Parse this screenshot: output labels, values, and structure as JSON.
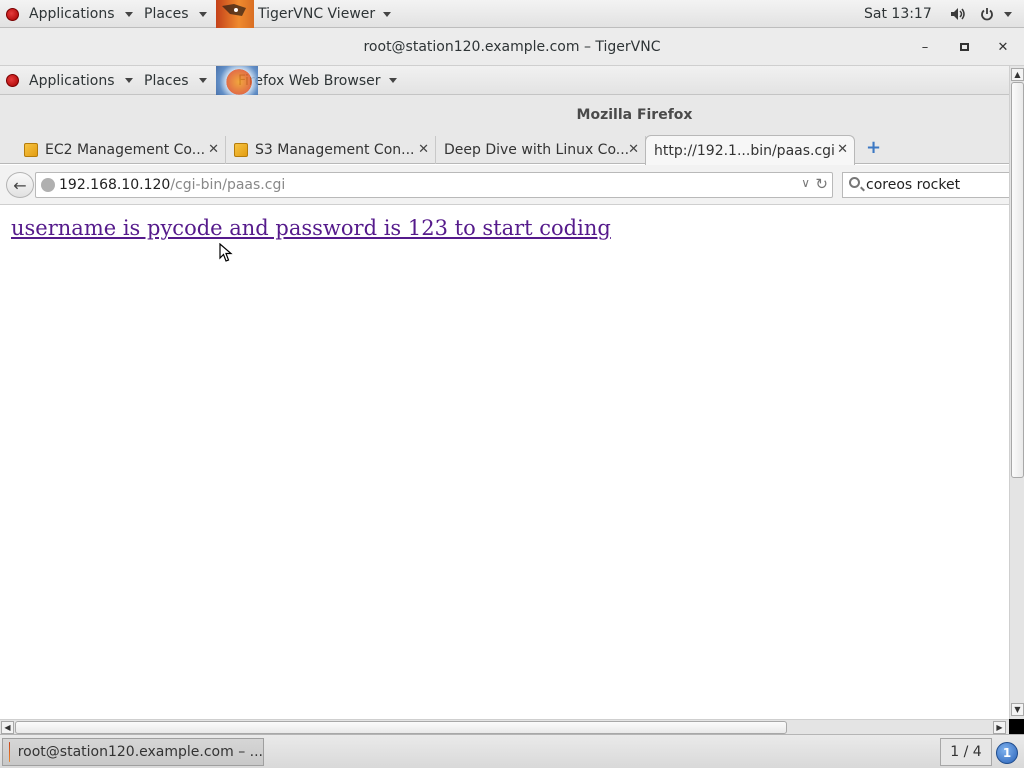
{
  "outer_topbar": {
    "applications": "Applications",
    "places": "Places",
    "app_name": "TigerVNC Viewer",
    "clock": "Sat 13:17"
  },
  "vnc_window": {
    "title": "root@station120.example.com – TigerVNC",
    "minimize": "–",
    "maximize": "▫",
    "close": "✕"
  },
  "inner_topbar": {
    "applications": "Applications",
    "places": "Places",
    "app_name": "Firefox Web Browser"
  },
  "firefox": {
    "title": "Mozilla Firefox",
    "tabs": [
      {
        "label": "EC2 Management Co...",
        "has_icon": true
      },
      {
        "label": "S3 Management Con...",
        "has_icon": true
      },
      {
        "label": "Deep Dive with Linux Co...",
        "has_icon": false
      },
      {
        "label": "http://192.1...bin/paas.cgi",
        "has_icon": false,
        "active": true
      }
    ],
    "new_tab": "+",
    "url_host": "192.168.10.120",
    "url_path": "/cgi-bin/paas.cgi",
    "search_value": "coreos rocket",
    "page_link": "username is pycode and password is 123 to start coding"
  },
  "taskbar": {
    "window_button": "root@station120.example.com – ...",
    "workspace": "1 / 4",
    "notification_count": "1"
  },
  "colors": {
    "visited_link": "#551a8b",
    "redhat": "#cc0000",
    "newtab_plus": "#3c78c3"
  }
}
